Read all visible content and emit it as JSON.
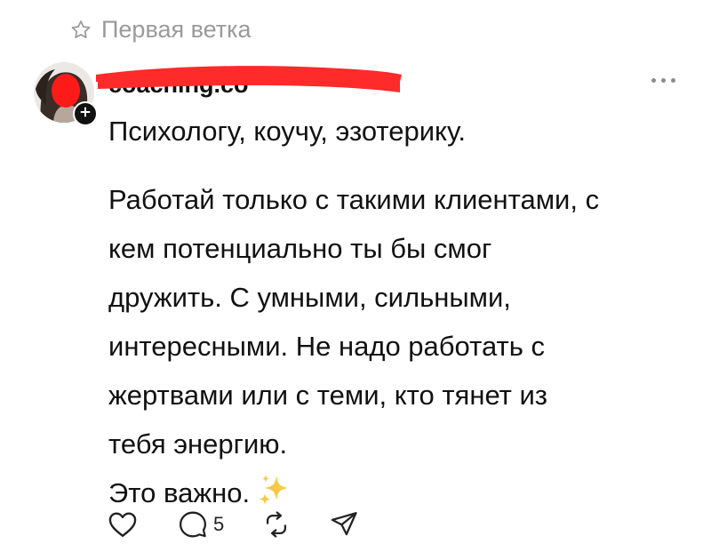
{
  "thread": {
    "label": "Первая ветка"
  },
  "post": {
    "username": "coaching.co",
    "title": "Психологу, коучу, эзотерику.",
    "text_lines": [
      "Работай только с такими клиентами, с",
      "кем потенциально ты бы смог",
      "дружить. С умными, сильными,",
      "интересными. Не надо работать с",
      "жертвами или с теми, кто тянет из",
      "тебя энергию.",
      "Это важно."
    ],
    "reply_count": "5"
  },
  "icons": {
    "thread": "star-icon",
    "more": "more-icon",
    "like": "heart-icon",
    "reply": "comment-icon",
    "repost": "repost-icon",
    "share": "send-icon",
    "emoji": "sparkles-icon",
    "follow": "plus-icon"
  },
  "colors": {
    "text": "#111111",
    "muted": "#9a9a9a",
    "redaction": "#ff2a2a"
  }
}
